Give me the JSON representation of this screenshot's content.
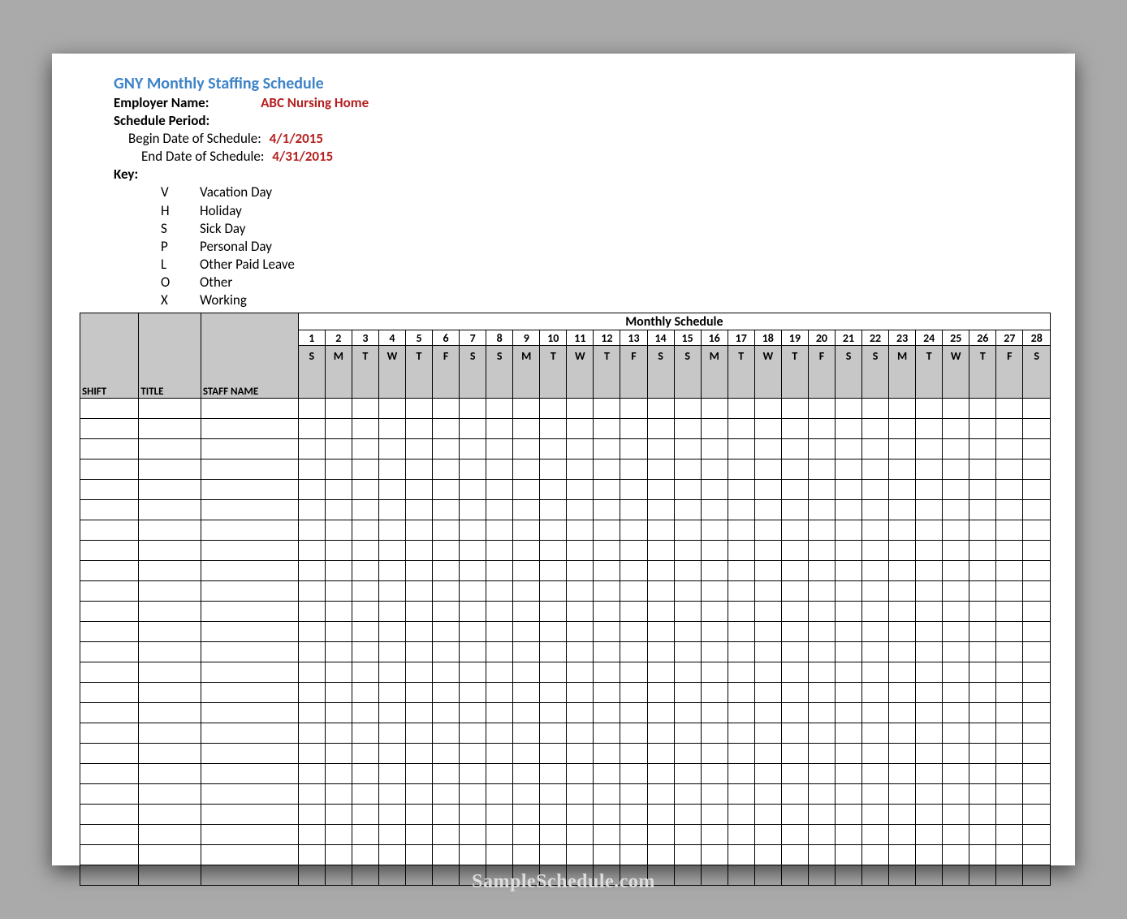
{
  "title": "GNY Monthly Staffing Schedule",
  "employer_label": "Employer Name:",
  "employer_value": "ABC Nursing Home",
  "schedule_period_label": "Schedule Period:",
  "begin_label": "Begin Date of Schedule:",
  "begin_value": "4/1/2015",
  "end_label": "End Date of Schedule:",
  "end_value": "4/31/2015",
  "key_label": "Key:",
  "keys": [
    {
      "code": "V",
      "meaning": "Vacation Day"
    },
    {
      "code": "H",
      "meaning": "Holiday"
    },
    {
      "code": "S",
      "meaning": "Sick Day"
    },
    {
      "code": "P",
      "meaning": "Personal Day"
    },
    {
      "code": "L",
      "meaning": "Other Paid Leave"
    },
    {
      "code": "O",
      "meaning": "Other"
    },
    {
      "code": "X",
      "meaning": "Working"
    }
  ],
  "table": {
    "monthly_header": "Monthly Schedule",
    "col_shift": "SHIFT",
    "col_title": "TITLE",
    "col_staff": "STAFF NAME",
    "day_nums": [
      "1",
      "2",
      "3",
      "4",
      "5",
      "6",
      "7",
      "8",
      "9",
      "10",
      "11",
      "12",
      "13",
      "14",
      "15",
      "16",
      "17",
      "18",
      "19",
      "20",
      "21",
      "22",
      "23",
      "24",
      "25",
      "26",
      "27",
      "28"
    ],
    "day_letters": [
      "S",
      "M",
      "T",
      "W",
      "T",
      "F",
      "S",
      "S",
      "M",
      "T",
      "W",
      "T",
      "F",
      "S",
      "S",
      "M",
      "T",
      "W",
      "T",
      "F",
      "S",
      "S",
      "M",
      "T",
      "W",
      "T",
      "F",
      "S"
    ],
    "empty_rows": 24
  },
  "watermark": "SampleSchedule.com"
}
